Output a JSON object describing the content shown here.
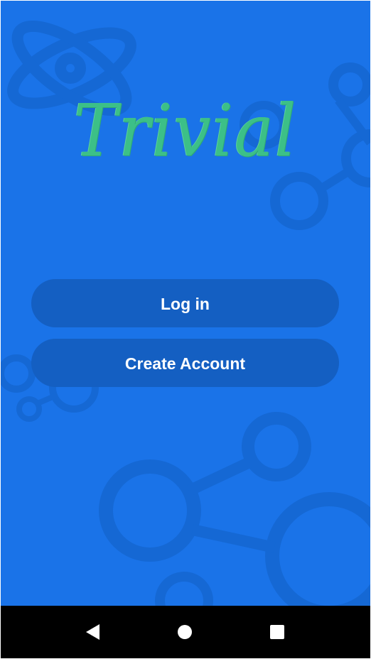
{
  "app": {
    "logo_text": "Trivial"
  },
  "buttons": {
    "login_label": "Log in",
    "create_account_label": "Create Account"
  },
  "navigation": {
    "back_icon": "back-triangle-icon",
    "home_icon": "home-circle-icon",
    "recents_icon": "recents-square-icon"
  },
  "colors": {
    "background": "#1a73e8",
    "button": "#145fc2",
    "button_text": "#ffffff",
    "logo": "#3cc087",
    "nav_bar": "#000000",
    "nav_icons": "#ffffff"
  }
}
